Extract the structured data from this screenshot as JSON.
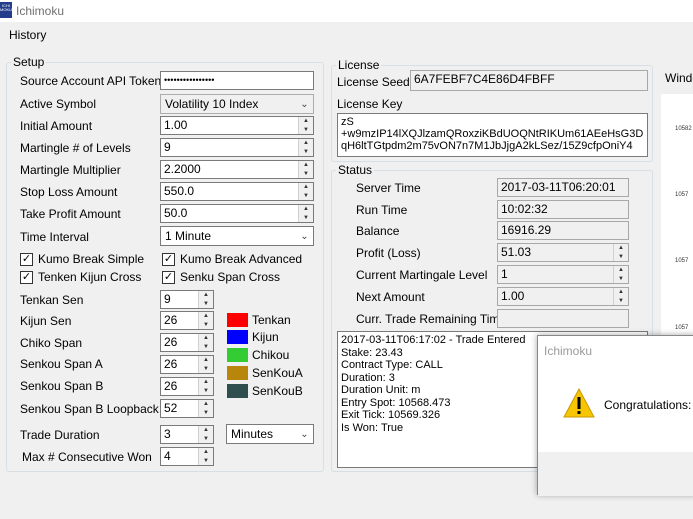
{
  "window": {
    "title": "Ichimoku",
    "icon_text": "ICHI MOKU"
  },
  "menu": {
    "history": "History"
  },
  "setup": {
    "legend": "Setup",
    "source_token_label": "Source Account API Token",
    "source_token_value": "••••••••••••••••",
    "active_symbol_label": "Active Symbol",
    "active_symbol_value": "Volatility 10 Index",
    "initial_amount_label": "Initial Amount",
    "initial_amount_value": "1.00",
    "martingale_levels_label": "Martingle # of Levels",
    "martingale_levels_value": "9",
    "martingale_multiplier_label": "Martingle Multiplier",
    "martingale_multiplier_value": "2.2000",
    "stop_loss_label": "Stop Loss Amount",
    "stop_loss_value": "550.0",
    "take_profit_label": "Take Profit Amount",
    "take_profit_value": "50.0",
    "time_interval_label": "Time Interval",
    "time_interval_value": "1 Minute",
    "checks": {
      "kumo_simple": "Kumo Break Simple",
      "kumo_advanced": "Kumo Break Advanced",
      "tenken_kijun": "Tenken Kijun Cross",
      "senku_span": "Senku Span Cross",
      "check_mark": "✓"
    },
    "tenkan_sen_label": "Tenkan Sen",
    "tenkan_sen_value": "9",
    "kijun_sen_label": "Kijun Sen",
    "kijun_sen_value": "26",
    "chiko_span_label": "Chiko Span",
    "chiko_span_value": "26",
    "senkou_a_label": "Senkou Span A",
    "senkou_a_value": "26",
    "senkou_b_label": "Senkou Span B",
    "senkou_b_value": "26",
    "senkou_b_loopback_label": "Senkou Span B Loopback",
    "senkou_b_loopback_value": "52",
    "trade_duration_label": "Trade Duration",
    "trade_duration_value": "3",
    "trade_duration_unit": "Minutes",
    "max_won_label": "Max # Consecutive Won",
    "max_won_value": "4",
    "legend_colors": [
      {
        "name": "Tenkan",
        "color": "#ff0000"
      },
      {
        "name": "Kijun",
        "color": "#0000ff"
      },
      {
        "name": "Chikou",
        "color": "#33cc33"
      },
      {
        "name": "SenKouA",
        "color": "#b8860b"
      },
      {
        "name": "SenKouB",
        "color": "#2f4f4f"
      }
    ]
  },
  "license": {
    "legend": "License",
    "seed_label": "License Seed",
    "seed_value": "6A7FEBF7C4E86D4FBFF",
    "key_label": "License Key",
    "key_lines": [
      "zS",
      "+w9mzIP14lXQJlzamQRoxziKBdUOQNtRIKUm61AEeHsG3D",
      "qH6ltTGtpdm2m75vON7n7M1JbJjgA2kLSez/15Z9cfpOniY4"
    ]
  },
  "status": {
    "legend": "Status",
    "server_time_label": "Server Time",
    "server_time_value": "2017-03-11T06:20:01",
    "run_time_label": "Run Time",
    "run_time_value": "10:02:32",
    "balance_label": "Balance",
    "balance_value": "16916.29",
    "profit_label": "Profit (Loss)",
    "profit_value": "51.03",
    "martingale_level_label": "Current Martingale Level",
    "martingale_level_value": "1",
    "next_amount_label": "Next Amount",
    "next_amount_value": "1.00",
    "remaining_label": "Curr. Trade Remaining Time",
    "remaining_value": "",
    "log_lines": [
      "2017-03-11T06:17:02 - Trade Entered",
      "Stake: 23.43",
      "Contract Type: CALL",
      "Duration: 3",
      "Duration Unit: m",
      "Entry Spot: 10568.473",
      "Exit Tick: 10569.326",
      "Is Won: True"
    ]
  },
  "window_panel": {
    "label": "Windo",
    "ticks": [
      "10582",
      "1057",
      "1057",
      "1057"
    ]
  },
  "dialog": {
    "title": "Ichimoku",
    "message": "Congratulations:"
  }
}
